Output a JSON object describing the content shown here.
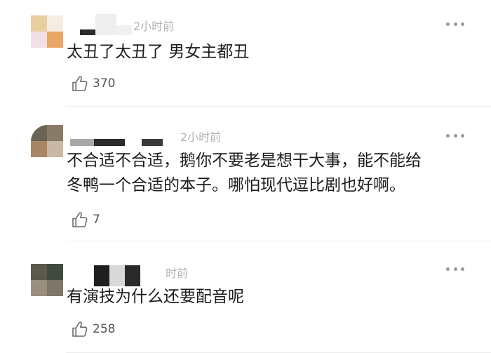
{
  "comments": [
    {
      "time": "2小时前",
      "text": "太丑了太丑了 男女主都丑",
      "likes": "370",
      "avatar_pixels": [
        "#e9cfa0",
        "#f4ede4",
        "#f3dfe6",
        "#e9a765"
      ],
      "username_pixels": [
        "#ffffff",
        "#2b2b2b",
        "#eeeeee",
        "#f1f1f1"
      ]
    },
    {
      "time": "2小时前",
      "text_lines": [
        "不合适不合适，鹅你不要老是想干大事，能不能给",
        "冬鸭一个合适的本子。哪怕现代逗比剧也好啊。"
      ],
      "likes": "7",
      "avatar_pixels": [
        "#6b6355",
        "#8a7a68",
        "#a98565",
        "#c9b8a6"
      ],
      "username_pixels": [
        "#a8a8a8",
        "#2a2a2a",
        "#ffffff",
        "#3a3a3a"
      ]
    },
    {
      "time": "时前",
      "text": "有演技为什么还要配音呢",
      "likes": "258",
      "avatar_pixels": [
        "#5b5a48",
        "#3f4b3f",
        "#9a8f7d",
        "#7e7668"
      ],
      "username_pixels": [
        "#ffffff",
        "#1f1f1f",
        "#d8d8d8",
        "#2a2a2a"
      ]
    }
  ],
  "colors": {
    "time_text": "#b3b3b3",
    "body_text": "#1c1c1c",
    "like_text": "#555555",
    "divider": "#ececec"
  },
  "icons": {
    "more": "more-dots-icon",
    "like": "thumbs-up-icon"
  }
}
